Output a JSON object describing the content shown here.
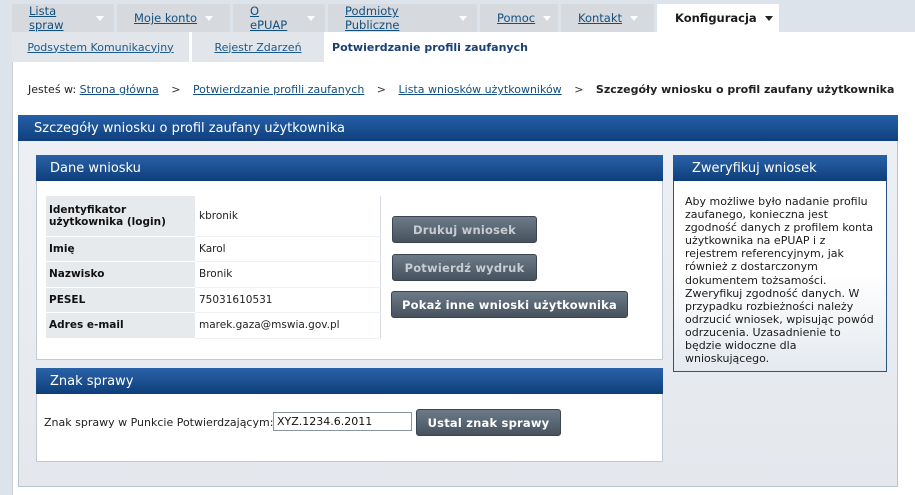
{
  "top_nav": [
    {
      "label": "Lista spraw",
      "active": false
    },
    {
      "label": "Moje konto",
      "active": false
    },
    {
      "label": "O ePUAP",
      "active": false
    },
    {
      "label": "Podmioty Publiczne",
      "active": false
    },
    {
      "label": "Pomoc",
      "active": false
    },
    {
      "label": "Kontakt",
      "active": false
    },
    {
      "label": "Konfiguracja",
      "active": true
    }
  ],
  "sub_nav": [
    {
      "label": "Podsystem Komunikacyjny",
      "active": false
    },
    {
      "label": "Rejestr Zdarzeń",
      "active": false
    },
    {
      "label": "Potwierdzanie profili zaufanych",
      "active": true
    }
  ],
  "breadcrumb": {
    "prefix": "Jesteś w:",
    "links": [
      "Strona główna",
      "Potwierdzanie profili zaufanych",
      "Lista wniosków użytkowników"
    ],
    "current": "Szczegóły wniosku o profil zaufany użytkownika"
  },
  "page_title": "Szczegóły wniosku o profil zaufany użytkownika",
  "dane_wniosku": {
    "title": "Dane wniosku",
    "rows": [
      {
        "label": "Identyfikator użytkownika (login)",
        "value": "kbronik"
      },
      {
        "label": "Imię",
        "value": "Karol"
      },
      {
        "label": "Nazwisko",
        "value": "Bronik"
      },
      {
        "label": "PESEL",
        "value": "75031610531"
      },
      {
        "label": "Adres e-mail",
        "value": "marek.gaza@mswia.gov.pl"
      }
    ],
    "buttons": {
      "print": "Drukuj wniosek",
      "confirm_print": "Potwierdź wydruk",
      "show_other": "Pokaż inne wnioski użytkownika"
    }
  },
  "zweryfikuj": {
    "title": "Zweryfikuj wniosek",
    "text": "Aby możliwe było nadanie profilu zaufanego, konieczna jest zgodność danych z profilem konta użytkownika na ePUAP i z rejestrem referencyjnym, jak również z dostarczonym dokumentem tożsamości. Zweryfikuj zgodność danych. W przypadku rozbieżności należy odrzucić wniosek, wpisując powód odrzucenia. Uzasadnienie to będzie widoczne dla wnioskującego."
  },
  "znak_sprawy": {
    "title": "Znak sprawy",
    "label": "Znak sprawy w Punkcie Potwierdzającym:",
    "value": "XYZ.1234.6.2011",
    "button": "Ustal znak sprawy"
  },
  "colors": {
    "header_blue": "#103f7d",
    "link_blue": "#12507e",
    "button_gray": "#47525e"
  }
}
